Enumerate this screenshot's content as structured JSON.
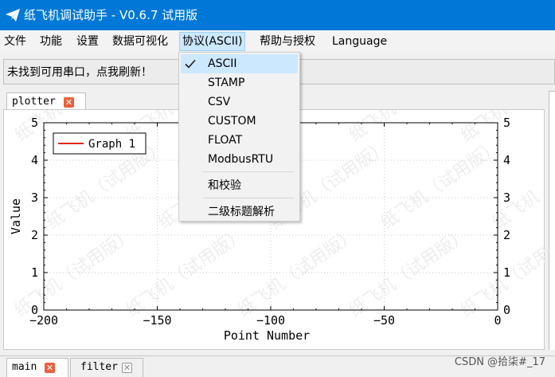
{
  "window": {
    "title": "纸飞机调试助手 - V0.6.7 试用版"
  },
  "menubar": {
    "items": [
      "文件",
      "功能",
      "设置",
      "数据可视化",
      "协议(ASCII)",
      "帮助与授权",
      "Language"
    ]
  },
  "port": {
    "message": "未找到可用串口，点我刷新！"
  },
  "tabs_top": {
    "plotter": "plotter"
  },
  "tabs_bottom": {
    "main": "main",
    "filter": "filter"
  },
  "protocol_menu": {
    "items": [
      "ASCII",
      "STAMP",
      "CSV",
      "CUSTOM",
      "FLOAT",
      "ModbusRTU",
      "和校验",
      "二级标题解析"
    ],
    "checked": "ASCII"
  },
  "chart_data": {
    "type": "line",
    "xlabel": "Point Number",
    "ylabel": "Value",
    "xlim": [
      -200,
      0
    ],
    "ylim": [
      0,
      5
    ],
    "x_ticks": [
      "−200",
      "−150",
      "−100",
      "−50",
      "0"
    ],
    "y_ticks": [
      "0",
      "1",
      "2",
      "3",
      "4",
      "5"
    ],
    "series": [
      {
        "name": "Graph 1",
        "color": "#e0281e",
        "x": [],
        "y": []
      }
    ],
    "legend": "top-left",
    "grid": true
  },
  "watermark": {
    "text": "纸飞机（试用版）"
  },
  "credit": {
    "text": "CSDN @拾柒#_17"
  }
}
